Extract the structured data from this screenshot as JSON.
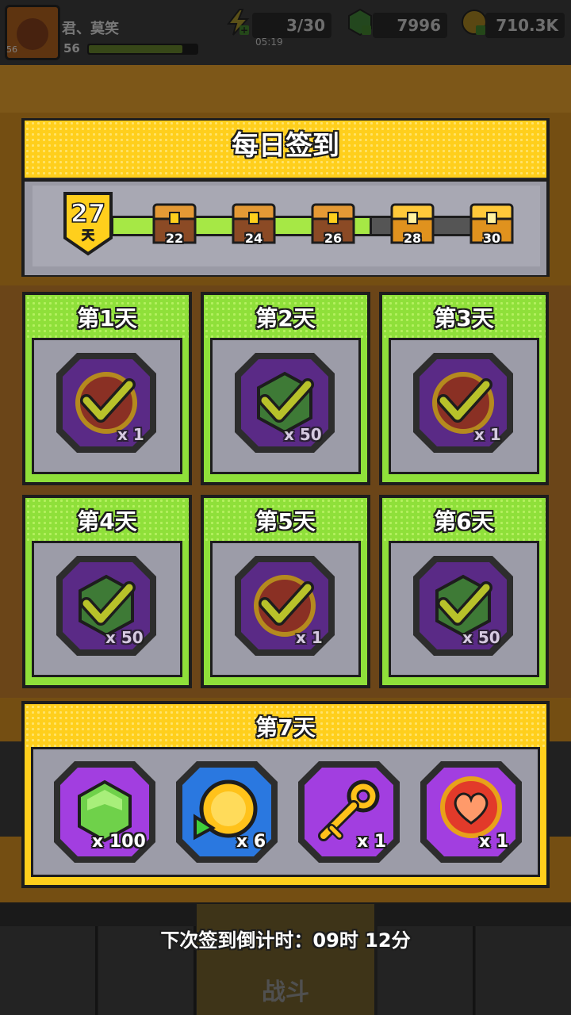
{
  "top_hud": {
    "player_name": "君、莫笑",
    "player_level": "56",
    "avatar_level": "56",
    "energy": "3/30",
    "energy_timer": "05:19",
    "gems": "7996",
    "coins": "710.3K"
  },
  "dialog": {
    "title": "每日签到",
    "current_streak": "27",
    "streak_unit": "天",
    "milestones": [
      {
        "day": "22",
        "state": "claimed"
      },
      {
        "day": "24",
        "state": "claimed"
      },
      {
        "day": "26",
        "state": "claimed"
      },
      {
        "day": "28",
        "state": "locked"
      },
      {
        "day": "30",
        "state": "locked"
      }
    ],
    "days": [
      {
        "label": "第1天",
        "reward_icon": "red-coin-icon",
        "qty": "x 1",
        "claimed": true
      },
      {
        "label": "第2天",
        "reward_icon": "green-gem-icon",
        "qty": "x 50",
        "claimed": true
      },
      {
        "label": "第3天",
        "reward_icon": "red-coin-icon",
        "qty": "x 1",
        "claimed": true
      },
      {
        "label": "第4天",
        "reward_icon": "green-gem-icon",
        "qty": "x 50",
        "claimed": true
      },
      {
        "label": "第5天",
        "reward_icon": "red-coin-icon",
        "qty": "x 1",
        "claimed": true
      },
      {
        "label": "第6天",
        "reward_icon": "green-gem-icon",
        "qty": "x 50",
        "claimed": true
      }
    ],
    "day7": {
      "label": "第7天",
      "rewards": [
        {
          "icon": "green-gem-icon",
          "qty": "x 100"
        },
        {
          "icon": "gold-coin-refresh-icon",
          "qty": "x 6"
        },
        {
          "icon": "gold-key-icon",
          "qty": "x 1"
        },
        {
          "icon": "heart-coin-icon",
          "qty": "x 1"
        }
      ]
    },
    "countdown": "下次签到倒计时：09时 12分"
  },
  "bottom_nav": {
    "battle_label": "战斗"
  },
  "colors": {
    "day_header_green": "#8fe03a",
    "title_yellow": "#ffcf1c",
    "slot_purple": "#7a2fb0",
    "outline": "#1d1d1d"
  }
}
